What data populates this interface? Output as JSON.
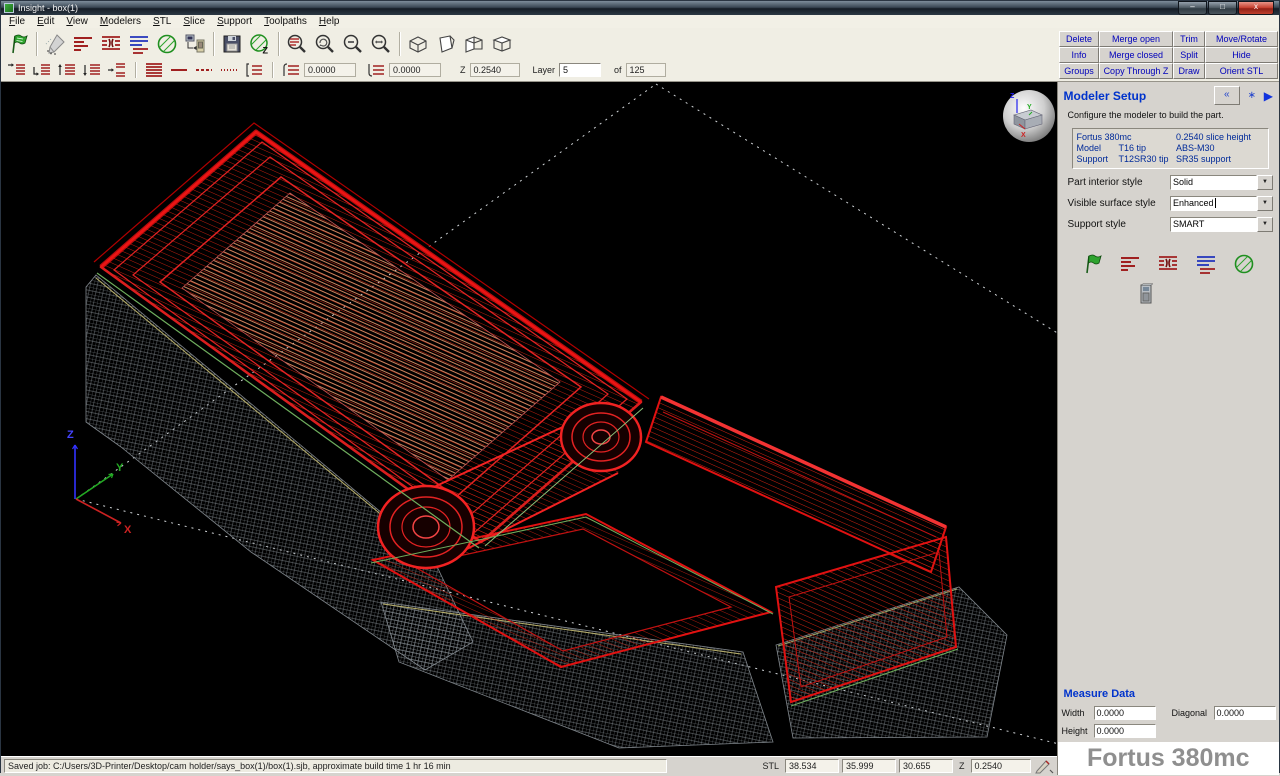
{
  "window": {
    "title": "Insight - box(1)"
  },
  "menu": [
    "File",
    "Edit",
    "View",
    "Modelers",
    "STL",
    "Slice",
    "Support",
    "Toolpaths",
    "Help"
  ],
  "toolbar": {
    "row1_icons": [
      "start-flag-icon",
      "draw-toolpaths-icon",
      "toolpath-layers-icon",
      "edit-toolpaths-icon",
      "group-layers-icon",
      "fill-style-icon",
      "send-to-modeler-icon",
      "save-icon",
      "slice-z-icon",
      "zoom-layer-icon",
      "zoom-rotate-icon",
      "zoom-out-icon",
      "zoom-extents-icon",
      "view-bottom-icon",
      "view-shaded-icon",
      "view-front-icon",
      "view-iso-icon"
    ],
    "row2_icons": [
      "go-first-layer-icon",
      "go-last-layer-icon",
      "layer-up-icon",
      "layer-down-icon",
      "go-to-layer-icon",
      "all-curves-icon",
      "single-curve-icon",
      "dashed-curve-icon",
      "dotted-curve-icon",
      "curve-group-icon",
      "top-of-part-icon",
      "bottom-of-part-icon"
    ],
    "field1": "0.0000",
    "field2": "0.0000",
    "z_label": "Z",
    "z_value": "0.2540",
    "layer_label": "Layer",
    "layer_value": "5",
    "of_label": "of",
    "layer_total": "125"
  },
  "right_panel": {
    "buttons": [
      [
        "Delete",
        "Merge open",
        "Trim",
        "Move/Rotate"
      ],
      [
        "Info",
        "Merge closed",
        "Split",
        "Hide"
      ],
      [
        "Groups",
        "Copy Through Z",
        "Draw",
        "Orient STL"
      ]
    ],
    "header": {
      "title": "Modeler Setup",
      "collapse_glyph": "«",
      "mini_glyph": "∗",
      "arrow_glyph": "▶",
      "subtitle": "Configure the modeler to build the part."
    },
    "info_box": {
      "rows": [
        {
          "left": "Fortus 380mc",
          "right": "0.2540 slice height"
        },
        {
          "left": "Model",
          "mid": "T16 tip",
          "right": "ABS-M30"
        },
        {
          "left": "Support",
          "mid": "T12SR30 tip",
          "right": "SR35 support"
        }
      ]
    },
    "settings": [
      {
        "label": "Part interior style",
        "value": "Solid"
      },
      {
        "label": "Visible surface style",
        "value": "Enhanced"
      },
      {
        "label": "Support style",
        "value": "SMART"
      }
    ],
    "icons": [
      "start-flag-icon",
      "toolpath-layers-icon",
      "edit-toolpaths-icon",
      "group-layers-icon",
      "fill-style-icon",
      "modeler-status-icon"
    ],
    "measure": {
      "title": "Measure Data",
      "width_label": "Width",
      "width_value": "0.0000",
      "height_label": "Height",
      "height_value": "0.0000",
      "diagonal_label": "Diagonal",
      "diagonal_value": "0.0000"
    },
    "brand": "Fortus 380mc"
  },
  "status_bar": {
    "message": "Saved job:  C:/Users/3D-Printer/Desktop/cam holder/says_box(1)/box(1).sjb,  approximate build time 1 hr 16 min",
    "stl_label": "STL",
    "stl_x": "38.534",
    "stl_y": "35.999",
    "stl_z": "30.655",
    "z_label": "Z",
    "z_value": "0.2540"
  },
  "viewport": {
    "axes": {
      "x": "X",
      "y": "Y",
      "z": "Z"
    },
    "nav_axes": {
      "x": "X",
      "y": "Y",
      "z": "Z"
    },
    "colors": {
      "model": "#ee1111",
      "interior": "#c9845e",
      "support": "#8e969c",
      "accent": "#6fae5e",
      "background": "#000000"
    }
  }
}
